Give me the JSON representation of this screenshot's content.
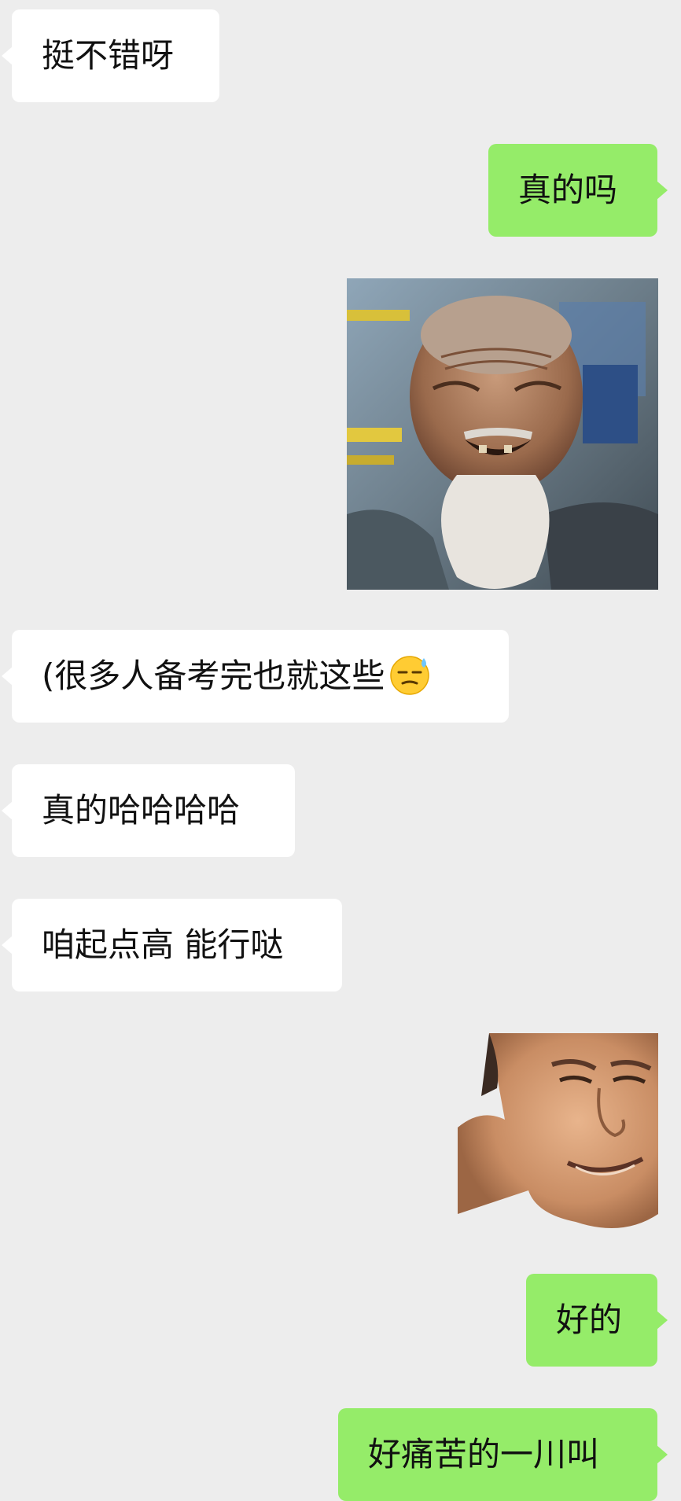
{
  "messages": [
    {
      "type": "text",
      "side": "left",
      "text": "挺不错呀"
    },
    {
      "type": "text",
      "side": "right",
      "text": "真的吗"
    },
    {
      "type": "image",
      "side": "right",
      "description": "old-man-laughing-sticker"
    },
    {
      "type": "text",
      "side": "left",
      "text": "(很多人备考完也就这些",
      "emoji": "sweat-smile-emoji"
    },
    {
      "type": "text",
      "side": "left",
      "text": "真的哈哈哈哈"
    },
    {
      "type": "text",
      "side": "left",
      "text": "咱起点高 能行哒"
    },
    {
      "type": "image",
      "side": "right",
      "description": "grimacing-man-sticker"
    },
    {
      "type": "text",
      "side": "right",
      "text": "好的"
    },
    {
      "type": "text",
      "side": "right",
      "text": "好痛苦的一川叫"
    }
  ],
  "colors": {
    "background": "#ededed",
    "incoming_bubble": "#ffffff",
    "outgoing_bubble": "#95ec69",
    "text": "#111111"
  }
}
